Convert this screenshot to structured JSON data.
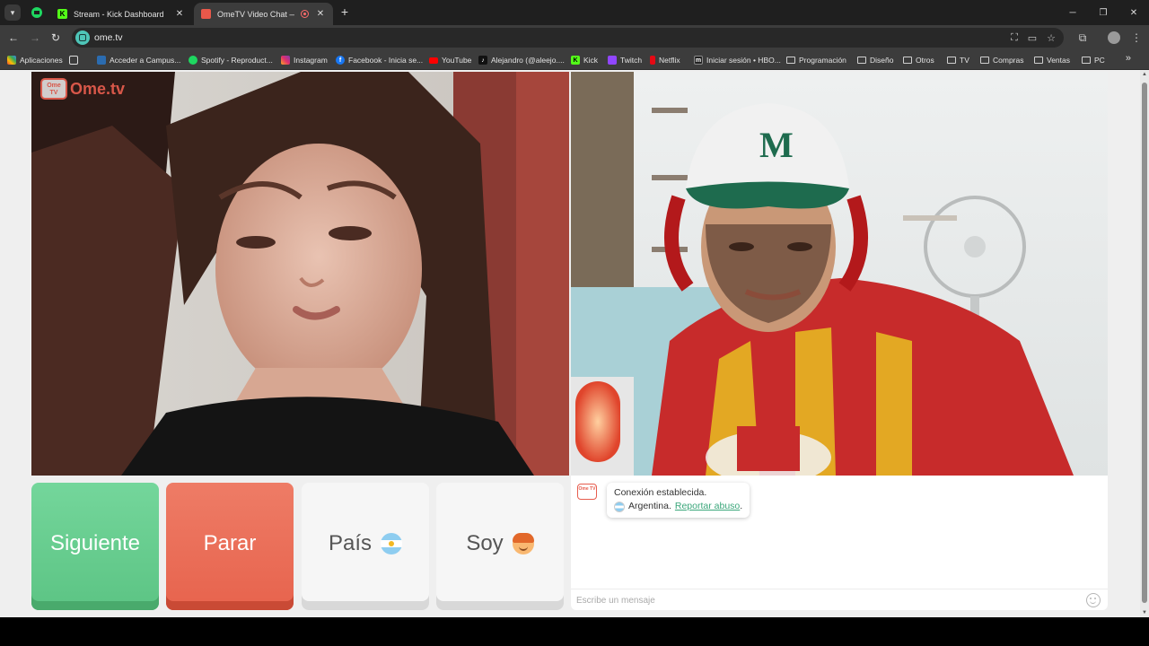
{
  "browser": {
    "tabs": [
      {
        "title": "Stream - Kick Dashboard",
        "icon": "kick-icon"
      },
      {
        "title": "OmeTV Video Chat — Ome",
        "icon": "ometv-icon",
        "recording": true
      }
    ],
    "url": "ome.tv",
    "bookmarks": [
      {
        "label": "Aplicaciones",
        "icon": "apps-grid-icon"
      },
      {
        "label": "",
        "icon": "grid-icon"
      },
      {
        "label": "Acceder a Campus...",
        "icon": "campus-icon"
      },
      {
        "label": "Spotify - Reproduct...",
        "icon": "spotify-icon"
      },
      {
        "label": "Instagram",
        "icon": "instagram-icon"
      },
      {
        "label": "Facebook - Inicia se...",
        "icon": "facebook-icon"
      },
      {
        "label": "YouTube",
        "icon": "youtube-icon"
      },
      {
        "label": "Alejandro (@aleejo....",
        "icon": "tiktok-icon"
      },
      {
        "label": "Kick",
        "icon": "kick-icon"
      },
      {
        "label": "Twitch",
        "icon": "twitch-icon"
      },
      {
        "label": "Netflix",
        "icon": "netflix-icon"
      },
      {
        "label": "Iniciar sesión • HBO...",
        "icon": "hbo-icon"
      },
      {
        "label": "Programación",
        "icon": "folder-icon"
      },
      {
        "label": "Diseño",
        "icon": "folder-icon"
      },
      {
        "label": "Otros",
        "icon": "folder-icon"
      },
      {
        "label": "TV",
        "icon": "folder-icon"
      },
      {
        "label": "Compras",
        "icon": "folder-icon"
      },
      {
        "label": "Ventas",
        "icon": "folder-icon"
      },
      {
        "label": "PC",
        "icon": "folder-icon"
      }
    ]
  },
  "app": {
    "logo_text": "Ome.tv",
    "logo_badge": "Ome TV",
    "accent_green": "#5cc484",
    "accent_red": "#e7634d",
    "buttons": {
      "next_label": "Siguiente",
      "stop_label": "Parar",
      "country_label": "País",
      "country_flag": "argentina-flag-icon",
      "gender_label": "Soy",
      "gender_icon": "boy-emoji-icon"
    },
    "chat": {
      "message_line1": "Conexión establecida.",
      "country": "Argentina.",
      "report_link": "Reportar abuso",
      "report_suffix": ".",
      "input_placeholder": "Escribe un mensaje"
    }
  }
}
